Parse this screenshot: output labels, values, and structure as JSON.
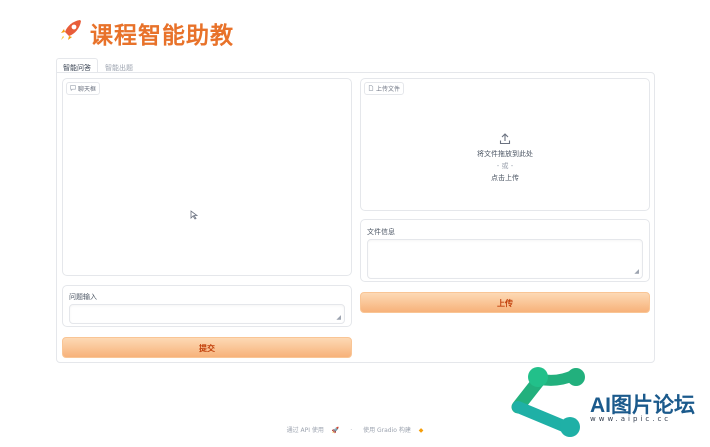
{
  "header": {
    "icon": "rocket-icon",
    "title": "课程智能助教"
  },
  "tabs": [
    {
      "label": "智能问答",
      "active": true
    },
    {
      "label": "智能出题",
      "active": false
    }
  ],
  "chat": {
    "label": "聊天框"
  },
  "question": {
    "label": "问题输入",
    "value": ""
  },
  "submit": {
    "label": "提交"
  },
  "upload": {
    "label": "上传文件",
    "drop_text": "将文件拖放到此处",
    "or_text": "- 或 -",
    "click_text": "点击上传"
  },
  "file_info": {
    "label": "文件信息",
    "value": ""
  },
  "upload_button": {
    "label": "上传"
  },
  "footer": {
    "api_text": "通过 API 使用",
    "separator": "·",
    "built_text": "使用 Gradio 构建"
  },
  "watermark": {
    "text": "AI图片论坛",
    "url": "www.aipic.cc"
  },
  "colors": {
    "accent": "#e8722a",
    "button_from": "#fdd9b5",
    "button_to": "#f7b27a",
    "watermark_green": "#22b07d",
    "watermark_blue": "#1b5a8c"
  }
}
